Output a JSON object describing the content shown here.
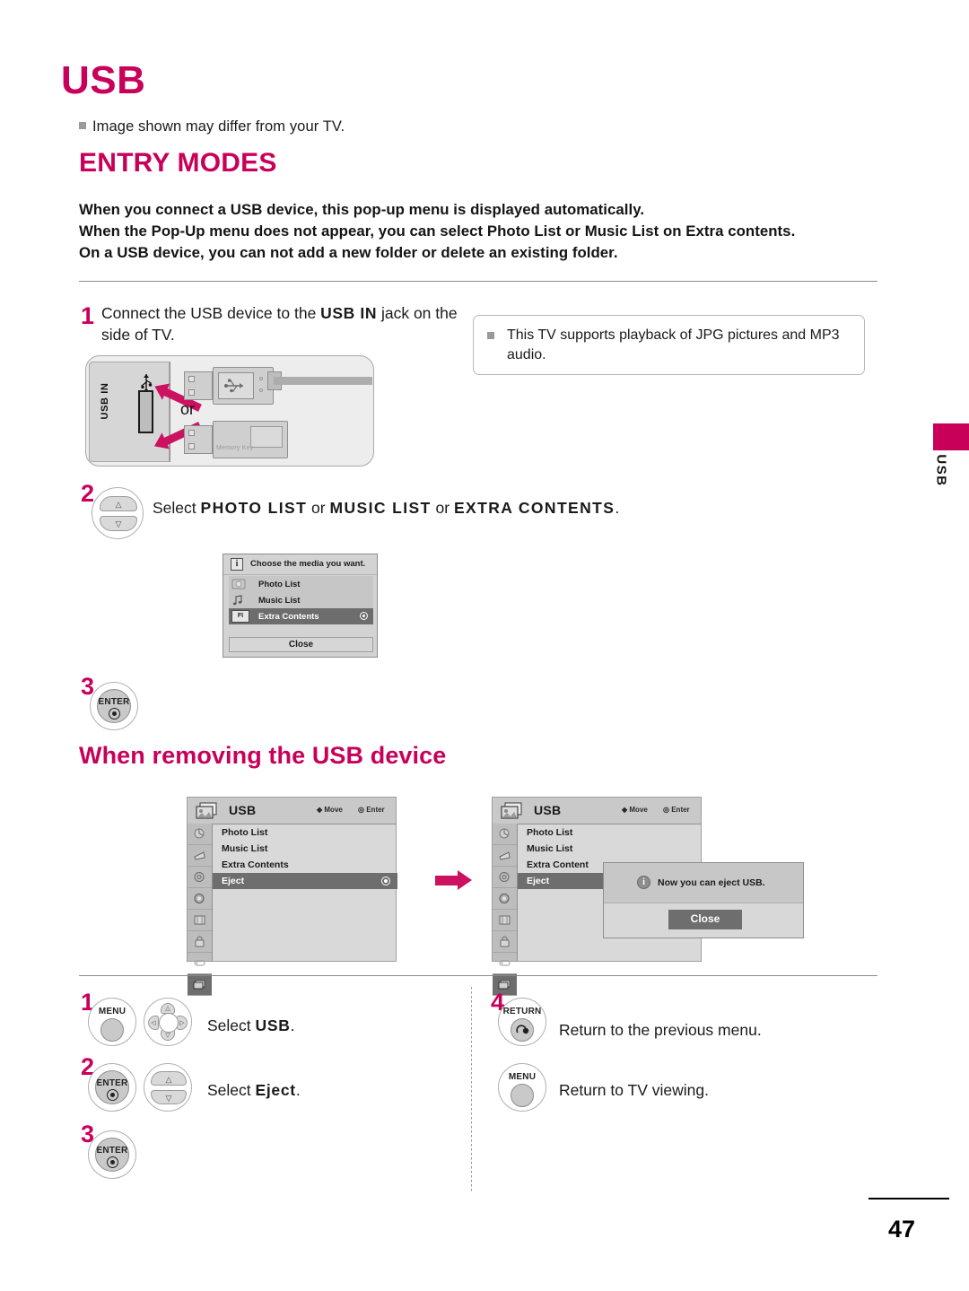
{
  "document": {
    "title": "USB",
    "page_number": "47",
    "side_tab_label": "USB",
    "accent_color": "#C8005A"
  },
  "top_note": "Image shown may differ from your TV.",
  "section": {
    "heading": "ENTRY MODES",
    "intro_lines": [
      "When you connect a USB device, this pop-up menu is displayed automatically.",
      "When the Pop-Up menu does not appear, you can select Photo List or Music List on Extra contents.",
      "On a USB device, you can not add a new folder or delete an existing folder."
    ]
  },
  "steps": {
    "one": {
      "number": "1",
      "text_before": "Connect the USB device to the ",
      "text_bold": "USB IN",
      "text_after": " jack on the side of TV."
    },
    "two": {
      "number": "2",
      "prefix": "Select ",
      "option1": "PHOTO LIST",
      "or1": " or ",
      "option2": "MUSIC LIST",
      "or2": " or ",
      "option3": "EXTRA CONTENTS",
      "suffix": "."
    },
    "three": {
      "number": "3",
      "button_label": "ENTER"
    }
  },
  "note_box": {
    "text": "This TV supports playback of JPG pictures and MP3 audio."
  },
  "diagram": {
    "port_label": "USB IN",
    "or_label": "or",
    "memory_key_label": "Memory Key"
  },
  "media_popup": {
    "info_icon": "i",
    "title": "Choose the media you want.",
    "items": [
      {
        "label": "Photo List",
        "icon": "photo-icon",
        "selected": false
      },
      {
        "label": "Music List",
        "icon": "music-note-icon",
        "selected": false
      },
      {
        "label": "Extra Contents",
        "icon": "FI",
        "selected": true
      }
    ],
    "close_label": "Close"
  },
  "removal_section": {
    "heading": "When removing the USB device"
  },
  "osd_left": {
    "title": "USB",
    "hint_move": "Move",
    "hint_enter": "Enter",
    "items": [
      {
        "label": "Photo List",
        "selected": false
      },
      {
        "label": "Music List",
        "selected": false
      },
      {
        "label": "Extra Contents",
        "selected": false
      },
      {
        "label": "Eject",
        "selected": true
      }
    ]
  },
  "osd_right": {
    "title": "USB",
    "hint_move": "Move",
    "hint_enter": "Enter",
    "items": [
      {
        "label": "Photo List",
        "selected": false
      },
      {
        "label": "Music List",
        "selected": false
      },
      {
        "label": "Extra Content",
        "selected": false
      },
      {
        "label": "Eject",
        "selected": true
      }
    ],
    "eject_popup": {
      "info_icon": "i",
      "message": "Now you can eject USB.",
      "close_label": "Close"
    }
  },
  "removal_steps_left": [
    {
      "number": "1",
      "buttons": [
        "MENU",
        "nav-pad"
      ],
      "text_prefix": "Select ",
      "text_bold": "USB",
      "text_suffix": "."
    },
    {
      "number": "2",
      "buttons": [
        "ENTER",
        "up-down"
      ],
      "text_prefix": "Select ",
      "text_bold": "Eject",
      "text_suffix": "."
    },
    {
      "number": "3",
      "buttons": [
        "ENTER"
      ],
      "text_prefix": "",
      "text_bold": "",
      "text_suffix": ""
    }
  ],
  "removal_steps_right": [
    {
      "number": "4",
      "button": "RETURN",
      "text": "Return to the previous menu."
    },
    {
      "number": "",
      "button": "MENU",
      "text": "Return to TV viewing."
    }
  ]
}
